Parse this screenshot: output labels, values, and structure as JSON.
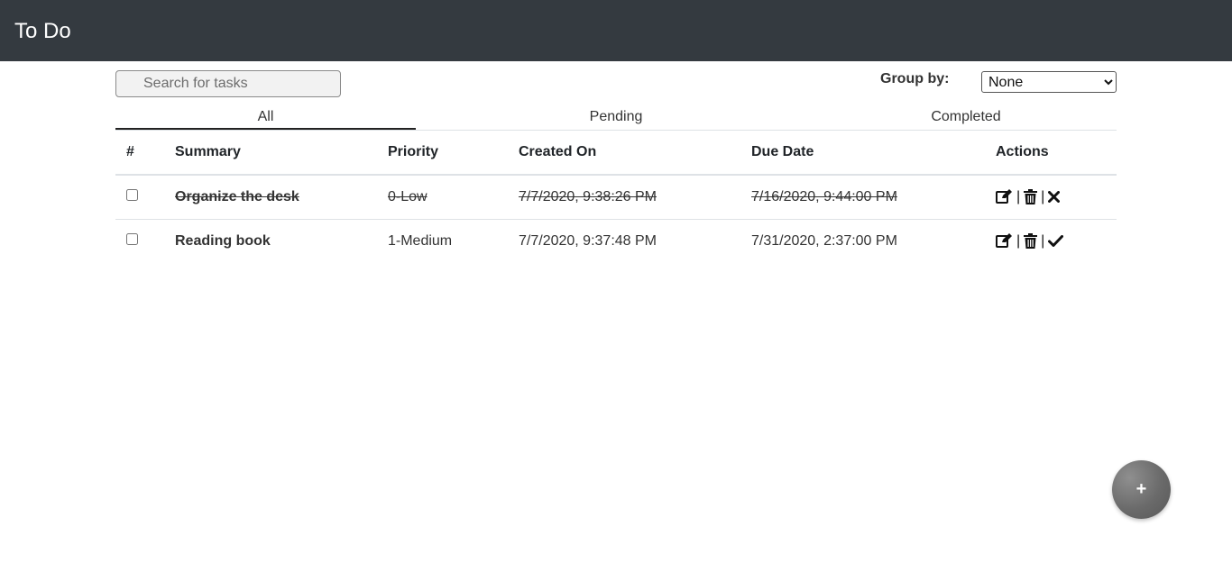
{
  "app": {
    "title": "To Do"
  },
  "search": {
    "placeholder": "Search for tasks",
    "value": ""
  },
  "group_by": {
    "label": "Group by:",
    "selected": "None",
    "options": [
      "None"
    ]
  },
  "tabs": [
    {
      "label": "All",
      "active": true
    },
    {
      "label": "Pending",
      "active": false
    },
    {
      "label": "Completed",
      "active": false
    }
  ],
  "table": {
    "columns": [
      "#",
      "Summary",
      "Priority",
      "Created On",
      "Due Date",
      "Actions"
    ],
    "rows": [
      {
        "checked": false,
        "summary": "Organize the desk",
        "priority": "0-Low",
        "created_on": "7/7/2020, 9:38:26 PM",
        "due_date": "7/16/2020, 9:44:00 PM",
        "completed": true,
        "actions": [
          "edit-icon",
          "trash-icon",
          "x-icon"
        ]
      },
      {
        "checked": false,
        "summary": "Reading book",
        "priority": "1-Medium",
        "created_on": "7/7/2020, 9:37:48 PM",
        "due_date": "7/31/2020, 2:37:00 PM",
        "completed": false,
        "actions": [
          "edit-icon",
          "trash-icon",
          "check-icon"
        ]
      }
    ],
    "action_separator": "|"
  },
  "fab": {
    "label": "+"
  },
  "colors": {
    "header_bg": "#343a40",
    "fab": "#6a6a6a"
  }
}
